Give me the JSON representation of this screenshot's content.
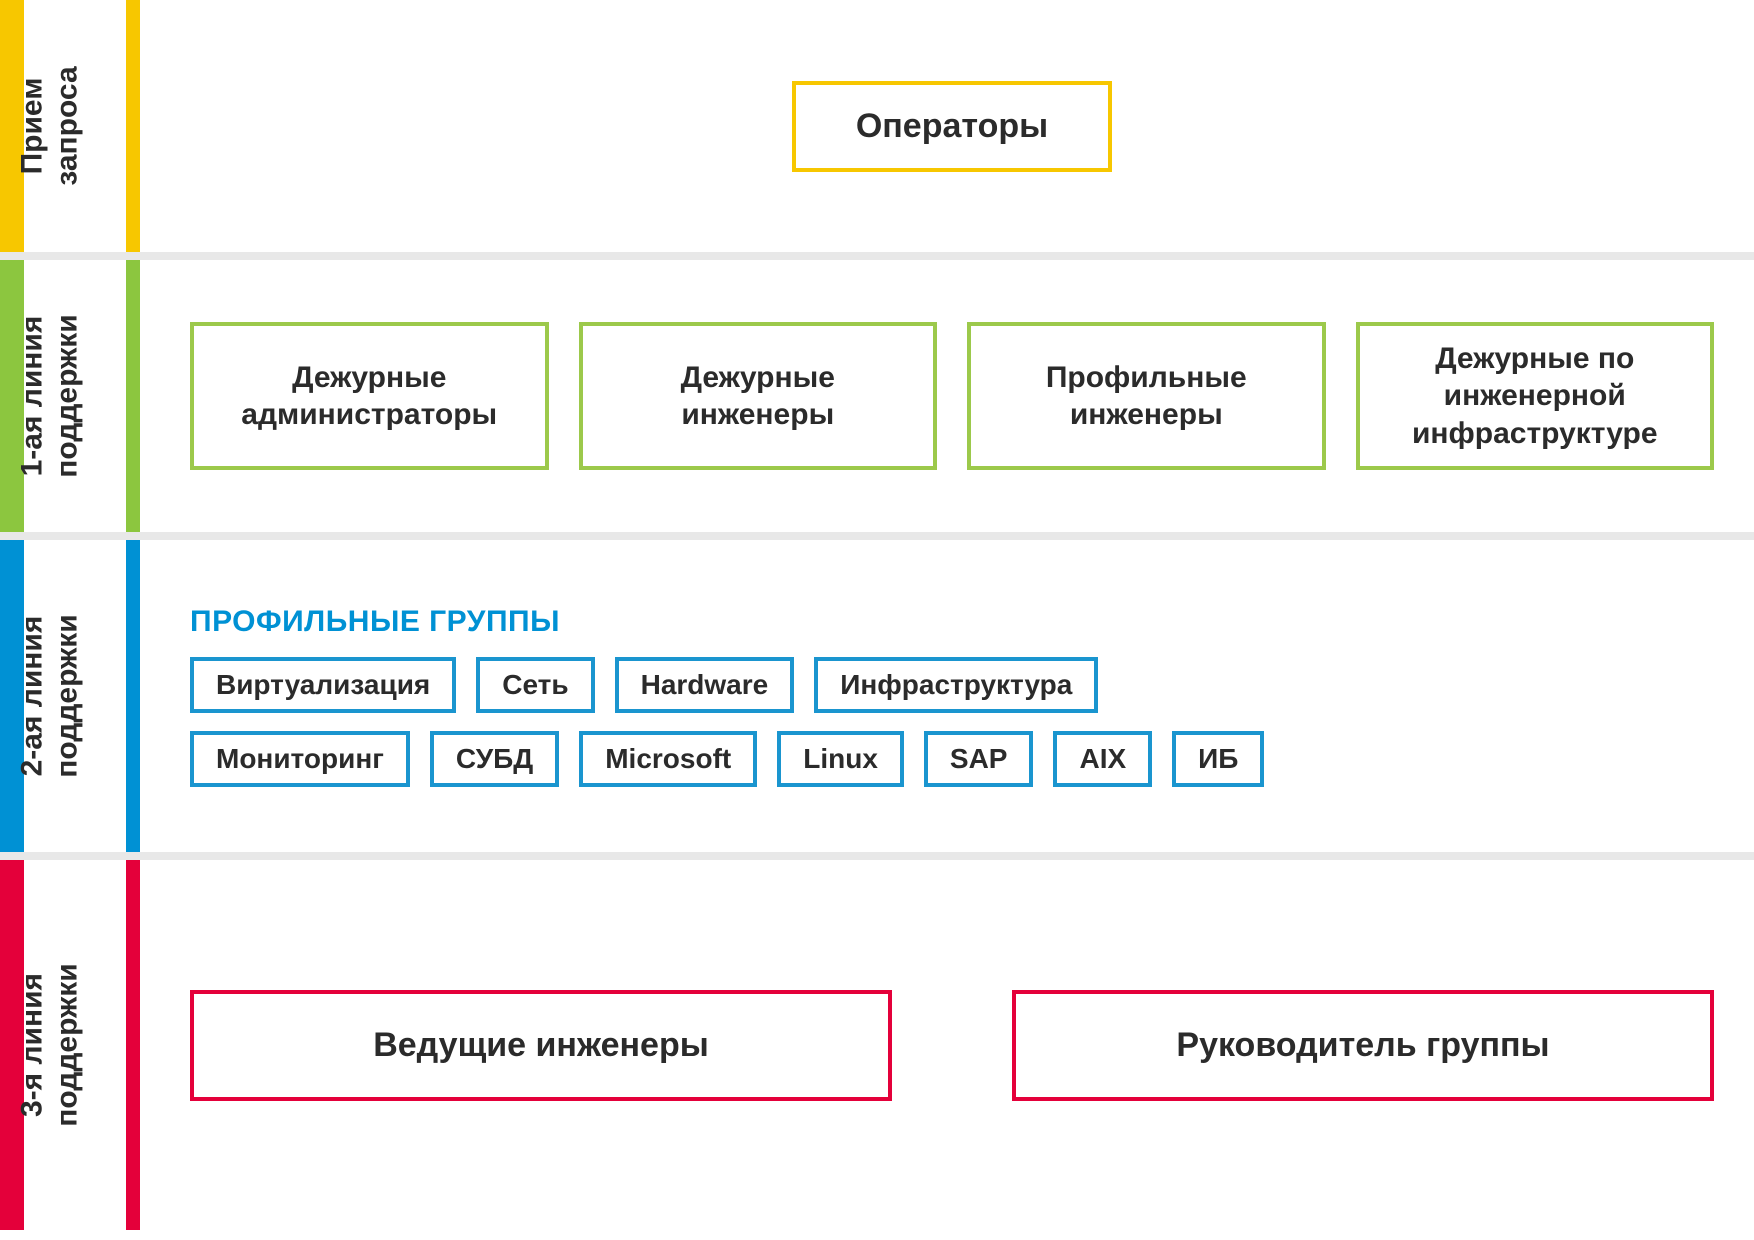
{
  "tiers": [
    {
      "label_line1": "Прием",
      "label_line2": "запроса",
      "color": "#f7c700",
      "boxes": [
        "Операторы"
      ]
    },
    {
      "label_line1": "1-ая линия",
      "label_line2": "поддержки",
      "color": "#8cc63f",
      "boxes": [
        "Дежурные администраторы",
        "Дежурные инженеры",
        "Профильные инженеры",
        "Дежурные по инженерной инфраструктуре"
      ]
    },
    {
      "label_line1": "2-ая линия",
      "label_line2": "поддержки",
      "color": "#0091d4",
      "heading": "ПРОФИЛЬНЫЕ ГРУППЫ",
      "row1": [
        "Виртуализация",
        "Сеть",
        "Hardware",
        "Инфраструктура"
      ],
      "row2": [
        "Мониторинг",
        "СУБД",
        "Microsoft",
        "Linux",
        "SAP",
        "AIX",
        "ИБ"
      ]
    },
    {
      "label_line1": "3-я линия",
      "label_line2": "поддержки",
      "color": "#e4003a",
      "boxes": [
        "Ведущие инженеры",
        "Руководитель группы"
      ]
    }
  ]
}
